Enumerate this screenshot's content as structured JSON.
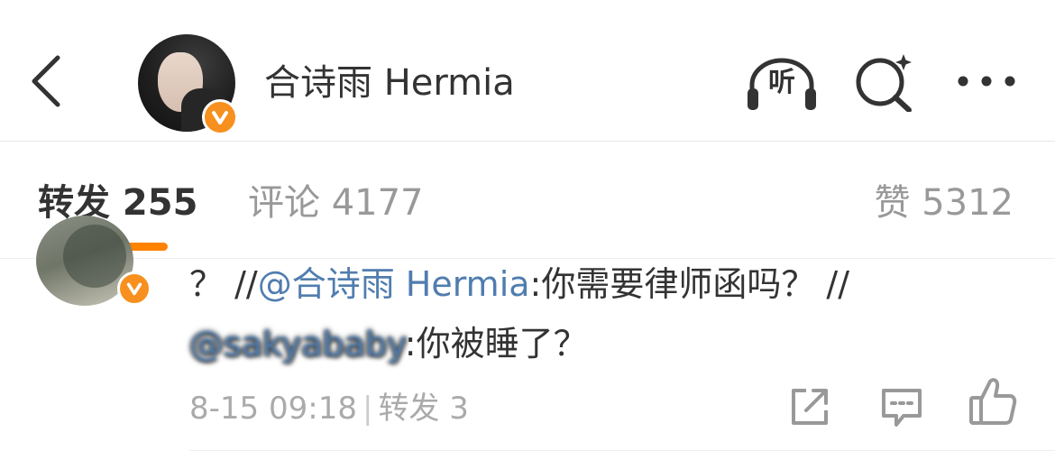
{
  "header": {
    "title": "合诗雨 Hermia",
    "listen_label": "听",
    "icons": [
      "back-icon",
      "listen-icon",
      "search-icon",
      "more-icon"
    ]
  },
  "tabs": {
    "repost_label": "转发 255",
    "comment_label": "评论 4177",
    "like_label": "赞 5312",
    "active": "repost"
  },
  "repost_item": {
    "line1_prefix": "？ //",
    "line1_mention": "@合诗雨 Hermia",
    "line1_text": ":你需要律师函吗？ //",
    "line2_mention": "@sakyababy",
    "line2_text": ":你被睡了？",
    "time": "8-15 09:18",
    "separator": "|",
    "repost_count": "转发 3"
  },
  "colors": {
    "accent": "#ff8200",
    "verified_badge": "#f7901e",
    "mention": "#507daf",
    "text": "#333333",
    "muted": "#999999"
  }
}
